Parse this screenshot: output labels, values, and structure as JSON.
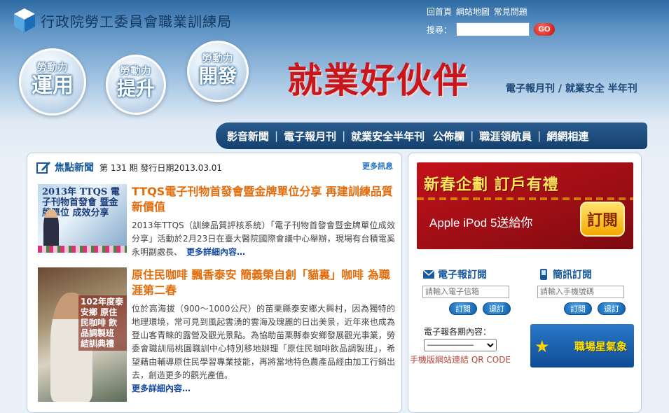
{
  "header": {
    "agency_name": "行政院勞工委員會職業訓練局",
    "top_links": [
      "回首頁",
      "網站地圖",
      "常見問題"
    ],
    "search_label": "搜尋：",
    "search_value": "",
    "go_label": "GO"
  },
  "bubbles": [
    {
      "small": "勞動力",
      "big": "運用"
    },
    {
      "small": "勞動力",
      "big": "提升"
    },
    {
      "small": "勞動力",
      "big": "開發"
    }
  ],
  "headline": "就業好伙伴",
  "subtitle": "電子報月刊 / 就業安全 半年刊",
  "nav": {
    "items": [
      "影音新聞",
      "電子報月刊",
      "就業安全半年刊",
      "公佈欄",
      "職涯領航員",
      "網網相連"
    ]
  },
  "news": {
    "section_title": "焦點新聞",
    "issue_info": "第 131 期 發行日期2013.03.01",
    "more_label": "更多訊息",
    "articles": [
      {
        "thumb_text": "2013年 TTQS 電子刊物首發會 暨金牌單位 成效分享",
        "title": "TTQS電子刊物首發會暨金牌單位分享 再建訓練品質新價值",
        "body": "2013年TTQS（訓練品質評核系統）「電子刊物首發會暨金牌單位成效分享」活動於2月23日在臺大醫院國際會議中心舉辦，現場有台積電奚永明副處長、",
        "more": "更多詳細內容…"
      },
      {
        "thumb_text": "102年度泰安鄉 原住民咖啡 飲品調製班 結訓典禮",
        "title": "原住民咖啡 飄香泰安 簡義榮自創「貓裏」咖啡 為職涯第二春",
        "body": "位於高海拔（900～1000公尺）的苗栗縣泰安鄉大興村，因為獨特的地理環境，常可見到風起雲湧的雲海及瑰麗的日出美景，近年來也成為登山客青睞的露營及觀光景點。為協助苗栗縣泰安鄉發展觀光事業，勞委會職訓局桃園職訓中心特別移地辦理「原住民咖啡飲品調製班」，希望藉由輔導原住民學習專業技能，再將當地特色農產品經由加工行銷出去，創造更多的觀光產值。",
        "more": "更多詳細內容…"
      }
    ]
  },
  "promo": {
    "title": "新春企劃 訂戶有禮",
    "text": "Apple iPod 5送給你",
    "button": "訂閱"
  },
  "subscribe": {
    "newsletter": {
      "title": "電子報訂閱",
      "placeholder": "請輸入電子信箱",
      "subscribe_btn": "訂閱",
      "unsubscribe_btn": "退訂"
    },
    "sms": {
      "title": "簡訊訂閱",
      "placeholder": "請輸入手機號碼",
      "subscribe_btn": "訂閱",
      "unsubscribe_btn": "退訂"
    }
  },
  "issues": {
    "label": "電子報各期內容：",
    "selected": "——————"
  },
  "qr_link": "手機版網站連結 QR CODE",
  "star_banner": "職場星氣象",
  "colors": {
    "headline_red": "#c8161d",
    "nav_blue": "#1c4a7a",
    "title_orange": "#e46c0a",
    "link_blue": "#1448a0"
  }
}
